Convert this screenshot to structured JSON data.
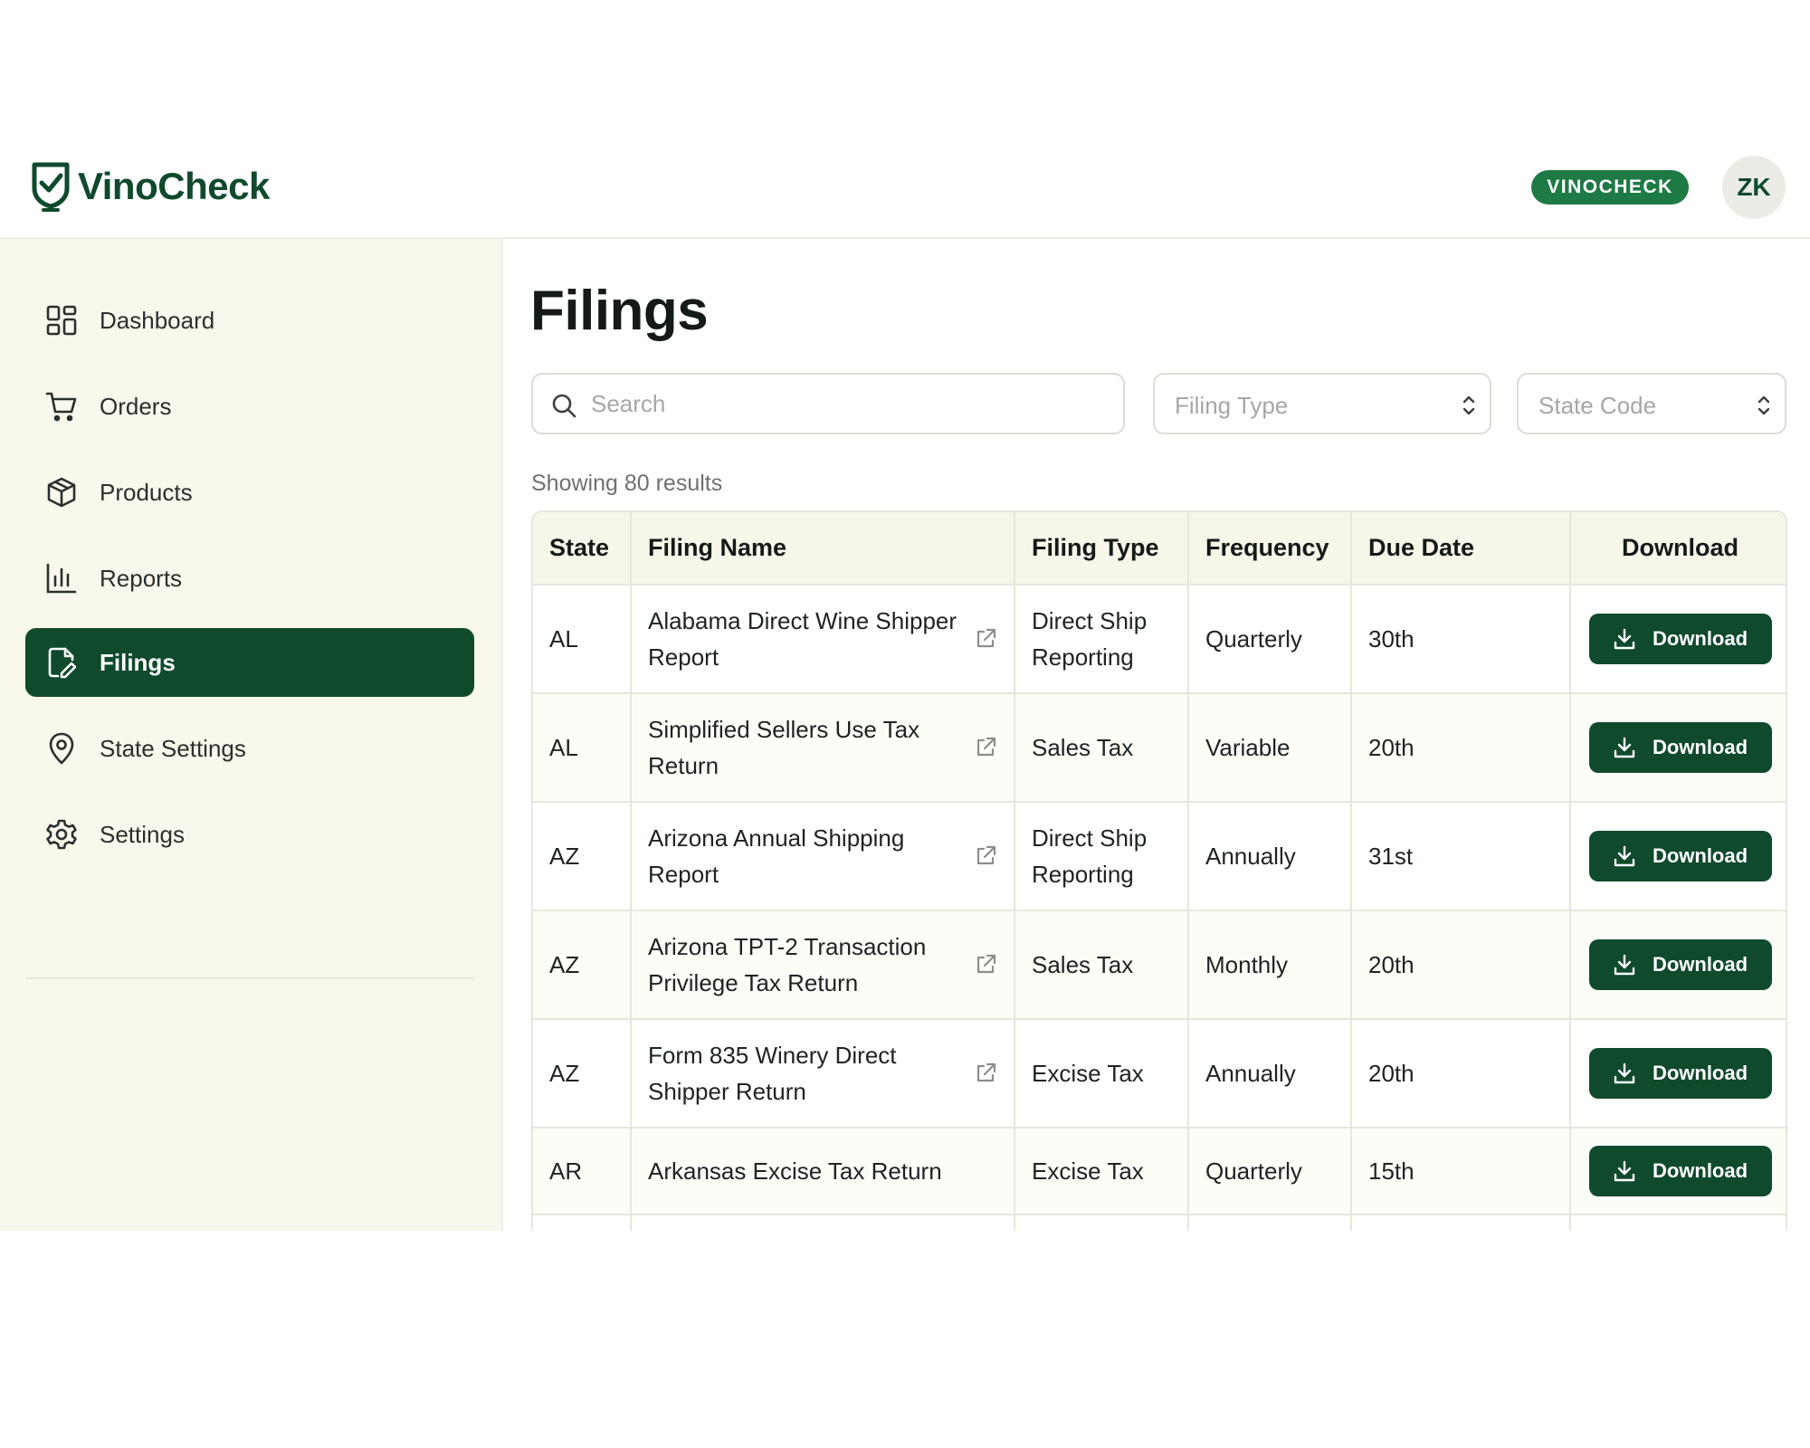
{
  "header": {
    "logo_text": "VinoCheck",
    "org_badge": "VINOCHECK",
    "avatar_initials": "ZK"
  },
  "sidebar": {
    "items": [
      {
        "label": "Dashboard",
        "icon": "dashboard-grid-icon"
      },
      {
        "label": "Orders",
        "icon": "shopping-cart-icon"
      },
      {
        "label": "Products",
        "icon": "box-icon"
      },
      {
        "label": "Reports",
        "icon": "bar-chart-icon"
      },
      {
        "label": "Filings",
        "icon": "document-edit-icon",
        "active": true
      },
      {
        "label": "State Settings",
        "icon": "map-pin-icon"
      },
      {
        "label": "Settings",
        "icon": "gear-icon"
      }
    ]
  },
  "main": {
    "title": "Filings",
    "search_placeholder": "Search",
    "filing_type_placeholder": "Filing Type",
    "state_code_placeholder": "State Code",
    "results_text": "Showing 80 results"
  },
  "table": {
    "columns": [
      "State",
      "Filing Name",
      "Filing Type",
      "Frequency",
      "Due Date",
      "Download"
    ],
    "download_label": "Download",
    "rows": [
      {
        "state": "AL",
        "name": "Alabama Direct Wine Shipper Report",
        "type": "Direct Ship Reporting",
        "frequency": "Quarterly",
        "due": "30th",
        "external_link": true
      },
      {
        "state": "AL",
        "name": "Simplified Sellers Use Tax Return",
        "type": "Sales Tax",
        "frequency": "Variable",
        "due": "20th",
        "external_link": true
      },
      {
        "state": "AZ",
        "name": "Arizona Annual Shipping Report",
        "type": "Direct Ship Reporting",
        "frequency": "Annually",
        "due": "31st",
        "external_link": true
      },
      {
        "state": "AZ",
        "name": "Arizona TPT-2 Transaction Privilege Tax Return",
        "type": "Sales Tax",
        "frequency": "Monthly",
        "due": "20th",
        "external_link": true
      },
      {
        "state": "AZ",
        "name": "Form 835 Winery Direct Shipper Return",
        "type": "Excise Tax",
        "frequency": "Annually",
        "due": "20th",
        "external_link": true
      },
      {
        "state": "AR",
        "name": "Arkansas Excise Tax Return",
        "type": "Excise Tax",
        "frequency": "Quarterly",
        "due": "15th",
        "external_link": false
      }
    ]
  },
  "colors": {
    "brand_dark": "#0f4a2c",
    "badge_green": "#1e7a45",
    "sidebar_bg": "#f8f8ec"
  }
}
